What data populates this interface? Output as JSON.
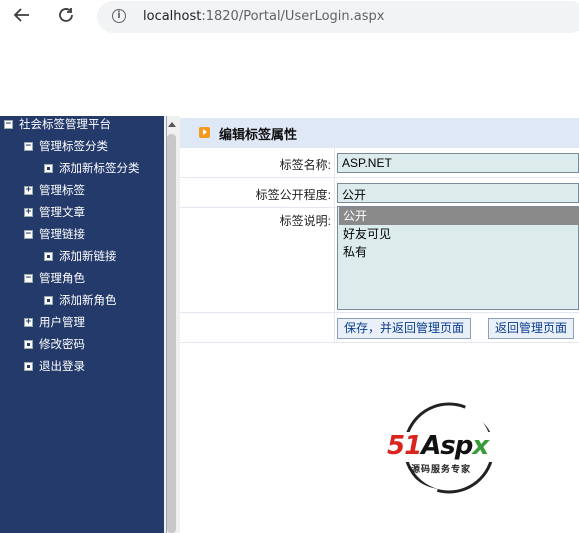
{
  "browser": {
    "url_host": "localhost",
    "url_path": ":1820/Portal/UserLogin.aspx"
  },
  "sidebar": {
    "root": "社会标签管理平台",
    "items": [
      {
        "label": "管理标签分类",
        "toggle": "−"
      },
      {
        "label": "添加新标签分类"
      },
      {
        "label": "管理标签",
        "toggle": "+"
      },
      {
        "label": "管理文章",
        "toggle": "+"
      },
      {
        "label": "管理链接",
        "toggle": "−"
      },
      {
        "label": "添加新链接"
      },
      {
        "label": "管理角色",
        "toggle": "−"
      },
      {
        "label": "添加新角色"
      },
      {
        "label": "用户管理",
        "toggle": "+"
      },
      {
        "label": "修改密码"
      },
      {
        "label": "退出登录"
      }
    ],
    "root_toggle": "−"
  },
  "form": {
    "title": "编辑标签属性",
    "name_label": "标签名称:",
    "name_value": "ASP.NET",
    "visibility_label": "标签公开程度:",
    "visibility_value": "公开",
    "desc_label": "标签说明:",
    "options": [
      "公开",
      "好友可见",
      "私有"
    ],
    "save_button": "保存，并返回管理页面",
    "back_button": "返回管理页面"
  },
  "watermark": {
    "brand": "51Aspx",
    "tagline": "源码服务专家"
  },
  "colors": {
    "sidebar_bg": "#233a6b",
    "header_bg": "#dfe8f6",
    "accent_orange": "#f39a1c",
    "field_bg": "#dcecec",
    "logo_red": "#d9251d",
    "logo_green": "#3a9a3a"
  }
}
